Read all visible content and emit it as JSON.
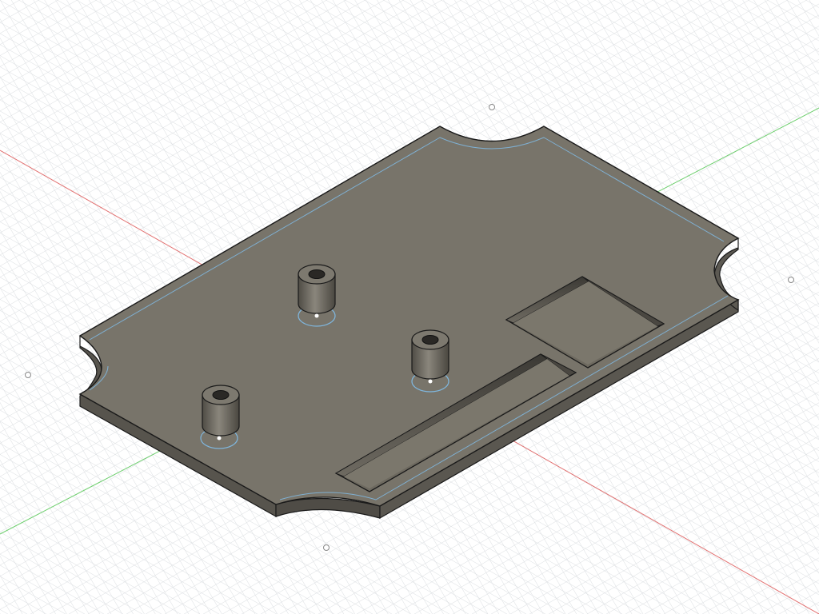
{
  "viewport": {
    "background": "#ffffff",
    "grid_color": "#d9dde0",
    "grid_major_color": "#c4c9cd",
    "x_axis_color": "#e05a5a",
    "y_axis_color": "#63c463"
  },
  "model": {
    "body_color": "#78746a",
    "side_color": "#5f5b53",
    "edge_color": "#1a1a1a",
    "selection_color": "#7fb6dd"
  },
  "features": {
    "bosses": [
      "boss-1",
      "boss-2",
      "boss-3"
    ],
    "pockets": [
      "square-pocket",
      "slot-pocket"
    ]
  }
}
